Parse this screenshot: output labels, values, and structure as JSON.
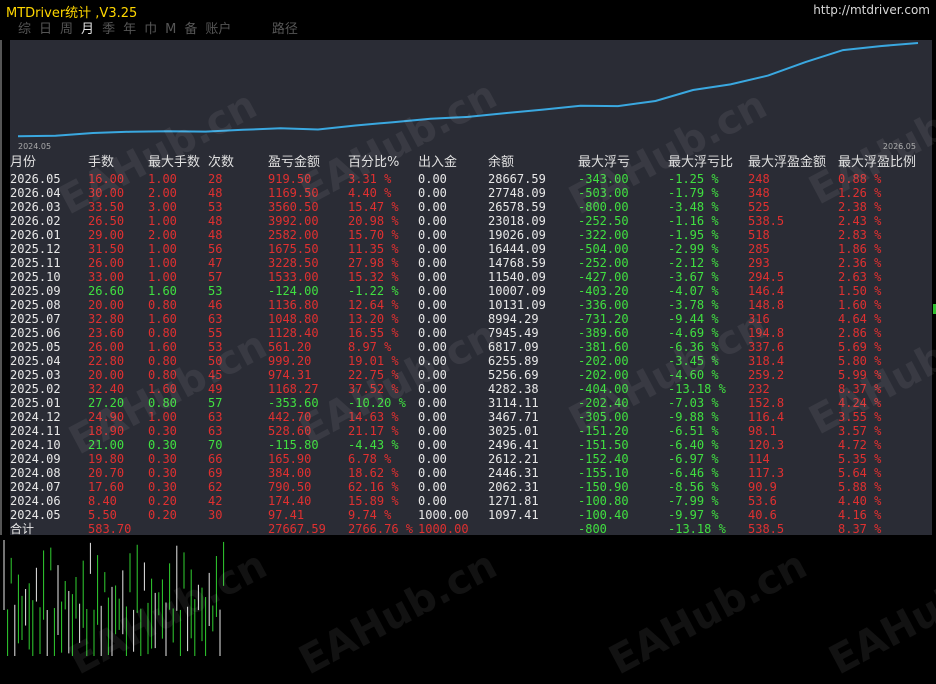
{
  "app_title": "MTDriver统计 ,V3.25",
  "site_url": "http://mtdriver.com",
  "tabs": [
    {
      "label": "综",
      "active": false
    },
    {
      "label": "日",
      "active": false
    },
    {
      "label": "周",
      "active": false
    },
    {
      "label": "月",
      "active": true
    },
    {
      "label": "季",
      "active": false
    },
    {
      "label": "年",
      "active": false
    },
    {
      "label": "巾",
      "active": false
    },
    {
      "label": "M",
      "active": false
    },
    {
      "label": "备",
      "active": false
    },
    {
      "label": "账户",
      "active": false
    },
    {
      "label": "",
      "active": false
    },
    {
      "label": "",
      "active": false
    },
    {
      "label": "路径",
      "active": false
    }
  ],
  "equity_chart": {
    "start_label": "2024.05",
    "end_label": "2026.05",
    "line_color": "#3aa8e0",
    "balances": [
      1097.41,
      1271.81,
      2062.31,
      2446.31,
      2612.21,
      2496.41,
      3025.01,
      3467.71,
      3114.11,
      4282.38,
      5256.69,
      6255.89,
      6817.09,
      7945.49,
      8994.29,
      10131.09,
      10007.09,
      11540.09,
      14768.59,
      16444.09,
      19026.09,
      23018.09,
      26578.59,
      27748.09,
      28667.59
    ]
  },
  "headers": [
    "月份",
    "手数",
    "最大手数",
    "次数",
    "盈亏金额",
    "百分比%",
    "出入金",
    "余额",
    "最大浮亏",
    "最大浮亏比",
    "最大浮盈金额",
    "最大浮盈比例"
  ],
  "rows": [
    {
      "month": "2026.05",
      "lots": "16.00",
      "max_lots": "1.00",
      "count": "28",
      "pl": "919.50",
      "pct": "3.31 %",
      "flow": "0.00",
      "bal": "28667.59",
      "max_dd": "-1,25 %",
      "dd_amt": "-343.00",
      "dd_pct": "-1.25 %",
      "fp_amt": "248",
      "fp_pct": "0.88 %",
      "win": true
    },
    {
      "month": "2026.04",
      "lots": "30.00",
      "max_lots": "2.00",
      "count": "48",
      "pl": "1169.50",
      "pct": "4.40 %",
      "flow": "0.00",
      "bal": "27748.09",
      "dd_amt": "-503.00",
      "dd_pct": "-1.79 %",
      "fp_amt": "348",
      "fp_pct": "1.26 %",
      "win": true
    },
    {
      "month": "2026.03",
      "lots": "33.50",
      "max_lots": "3.00",
      "count": "53",
      "pl": "3560.50",
      "pct": "15.47 %",
      "flow": "0.00",
      "bal": "26578.59",
      "dd_amt": "-800.00",
      "dd_pct": "-3.48 %",
      "fp_amt": "525",
      "fp_pct": "2.38 %",
      "win": true
    },
    {
      "month": "2026.02",
      "lots": "26.50",
      "max_lots": "1.00",
      "count": "48",
      "pl": "3992.00",
      "pct": "20.98 %",
      "flow": "0.00",
      "bal": "23018.09",
      "dd_amt": "-252.50",
      "dd_pct": "-1.16 %",
      "fp_amt": "538.5",
      "fp_pct": "2.43 %",
      "win": true
    },
    {
      "month": "2026.01",
      "lots": "29.00",
      "max_lots": "2.00",
      "count": "48",
      "pl": "2582.00",
      "pct": "15.70 %",
      "flow": "0.00",
      "bal": "19026.09",
      "dd_amt": "-322.00",
      "dd_pct": "-1.95 %",
      "fp_amt": "518",
      "fp_pct": "2.83 %",
      "win": true
    },
    {
      "month": "2025.12",
      "lots": "31.50",
      "max_lots": "1.00",
      "count": "56",
      "pl": "1675.50",
      "pct": "11.35 %",
      "flow": "0.00",
      "bal": "16444.09",
      "dd_amt": "-504.00",
      "dd_pct": "-2.99 %",
      "fp_amt": "285",
      "fp_pct": "1.86 %",
      "win": true
    },
    {
      "month": "2025.11",
      "lots": "26.00",
      "max_lots": "1.00",
      "count": "47",
      "pl": "3228.50",
      "pct": "27.98 %",
      "flow": "0.00",
      "bal": "14768.59",
      "dd_amt": "-252.00",
      "dd_pct": "-2.12 %",
      "fp_amt": "293",
      "fp_pct": "2.36 %",
      "win": true
    },
    {
      "month": "2025.10",
      "lots": "33.00",
      "max_lots": "1.00",
      "count": "57",
      "pl": "1533.00",
      "pct": "15.32 %",
      "flow": "0.00",
      "bal": "11540.09",
      "dd_amt": "-427.00",
      "dd_pct": "-3.67 %",
      "fp_amt": "294.5",
      "fp_pct": "2.63 %",
      "win": true
    },
    {
      "month": "2025.09",
      "lots": "26.60",
      "max_lots": "1.60",
      "count": "53",
      "pl": "-124.00",
      "pct": "-1.22 %",
      "flow": "0.00",
      "bal": "10007.09",
      "dd_amt": "-403.20",
      "dd_pct": "-4.07 %",
      "fp_amt": "146.4",
      "fp_pct": "1.50 %",
      "win": false
    },
    {
      "month": "2025.08",
      "lots": "20.00",
      "max_lots": "0.80",
      "count": "46",
      "pl": "1136.80",
      "pct": "12.64 %",
      "flow": "0.00",
      "bal": "10131.09",
      "dd_amt": "-336.00",
      "dd_pct": "-3.78 %",
      "fp_amt": "148.8",
      "fp_pct": "1.60 %",
      "win": true
    },
    {
      "month": "2025.07",
      "lots": "32.80",
      "max_lots": "1.60",
      "count": "63",
      "pl": "1048.80",
      "pct": "13.20 %",
      "flow": "0.00",
      "bal": "8994.29",
      "dd_amt": "-731.20",
      "dd_pct": "-9.44 %",
      "fp_amt": "316",
      "fp_pct": "4.64 %",
      "win": true
    },
    {
      "month": "2025.06",
      "lots": "23.60",
      "max_lots": "0.80",
      "count": "55",
      "pl": "1128.40",
      "pct": "16.55 %",
      "flow": "0.00",
      "bal": "7945.49",
      "dd_amt": "-389.60",
      "dd_pct": "-4.69 %",
      "fp_amt": "194.8",
      "fp_pct": "2.86 %",
      "win": true
    },
    {
      "month": "2025.05",
      "lots": "26.00",
      "max_lots": "1.60",
      "count": "53",
      "pl": "561.20",
      "pct": "8.97 %",
      "flow": "0.00",
      "bal": "6817.09",
      "dd_amt": "-381.60",
      "dd_pct": "-6.36 %",
      "fp_amt": "337.6",
      "fp_pct": "5.69 %",
      "win": true
    },
    {
      "month": "2025.04",
      "lots": "22.80",
      "max_lots": "0.80",
      "count": "50",
      "pl": "999.20",
      "pct": "19.01 %",
      "flow": "0.00",
      "bal": "6255.89",
      "dd_amt": "-202.00",
      "dd_pct": "-3.45 %",
      "fp_amt": "318.4",
      "fp_pct": "5.80 %",
      "win": true
    },
    {
      "month": "2025.03",
      "lots": "20.00",
      "max_lots": "0.80",
      "count": "45",
      "pl": "974.31",
      "pct": "22.75 %",
      "flow": "0.00",
      "bal": "5256.69",
      "dd_amt": "-202.00",
      "dd_pct": "-4.60 %",
      "fp_amt": "259.2",
      "fp_pct": "5.99 %",
      "win": true
    },
    {
      "month": "2025.02",
      "lots": "32.40",
      "max_lots": "1.60",
      "count": "49",
      "pl": "1168.27",
      "pct": "37.52 %",
      "flow": "0.00",
      "bal": "4282.38",
      "dd_amt": "-404.00",
      "dd_pct": "-13.18 %",
      "fp_amt": "232",
      "fp_pct": "8.37 %",
      "win": true
    },
    {
      "month": "2025.01",
      "lots": "27.20",
      "max_lots": "0.80",
      "count": "57",
      "pl": "-353.60",
      "pct": "-10.20 %",
      "flow": "0.00",
      "bal": "3114.11",
      "dd_amt": "-202.40",
      "dd_pct": "-7.03 %",
      "fp_amt": "152.8",
      "fp_pct": "4.24 %",
      "win": false
    },
    {
      "month": "2024.12",
      "lots": "24.90",
      "max_lots": "1.00",
      "count": "63",
      "pl": "442.70",
      "pct": "14.63 %",
      "flow": "0.00",
      "bal": "3467.71",
      "dd_amt": "-305.00",
      "dd_pct": "-9.88 %",
      "fp_amt": "116.4",
      "fp_pct": "3.55 %",
      "win": true
    },
    {
      "month": "2024.11",
      "lots": "18.90",
      "max_lots": "0.30",
      "count": "63",
      "pl": "528.60",
      "pct": "21.17 %",
      "flow": "0.00",
      "bal": "3025.01",
      "dd_amt": "-151.20",
      "dd_pct": "-6.51 %",
      "fp_amt": "98.1",
      "fp_pct": "3.57 %",
      "win": true
    },
    {
      "month": "2024.10",
      "lots": "21.00",
      "max_lots": "0.30",
      "count": "70",
      "pl": "-115.80",
      "pct": "-4.43 %",
      "flow": "0.00",
      "bal": "2496.41",
      "dd_amt": "-151.50",
      "dd_pct": "-6.40 %",
      "fp_amt": "120.3",
      "fp_pct": "4.72 %",
      "win": false
    },
    {
      "month": "2024.09",
      "lots": "19.80",
      "max_lots": "0.30",
      "count": "66",
      "pl": "165.90",
      "pct": "6.78 %",
      "flow": "0.00",
      "bal": "2612.21",
      "dd_amt": "-152.40",
      "dd_pct": "-6.97 %",
      "fp_amt": "114",
      "fp_pct": "5.35 %",
      "win": true
    },
    {
      "month": "2024.08",
      "lots": "20.70",
      "max_lots": "0.30",
      "count": "69",
      "pl": "384.00",
      "pct": "18.62 %",
      "flow": "0.00",
      "bal": "2446.31",
      "dd_amt": "-155.10",
      "dd_pct": "-6.46 %",
      "fp_amt": "117.3",
      "fp_pct": "5.64 %",
      "win": true
    },
    {
      "month": "2024.07",
      "lots": "17.60",
      "max_lots": "0.30",
      "count": "62",
      "pl": "790.50",
      "pct": "62.16 %",
      "flow": "0.00",
      "bal": "2062.31",
      "dd_amt": "-150.90",
      "dd_pct": "-8.56 %",
      "fp_amt": "90.9",
      "fp_pct": "5.88 %",
      "win": true
    },
    {
      "month": "2024.06",
      "lots": "8.40",
      "max_lots": "0.20",
      "count": "42",
      "pl": "174.40",
      "pct": "15.89 %",
      "flow": "0.00",
      "bal": "1271.81",
      "dd_amt": "-100.80",
      "dd_pct": "-7.99 %",
      "fp_amt": "53.6",
      "fp_pct": "4.40 %",
      "win": true
    },
    {
      "month": "2024.05",
      "lots": "5.50",
      "max_lots": "0.20",
      "count": "30",
      "pl": "97.41",
      "pct": "9.74 %",
      "flow": "1000.00",
      "bal": "1097.41",
      "dd_amt": "-100.40",
      "dd_pct": "-9.97 %",
      "fp_amt": "40.6",
      "fp_pct": "4.16 %",
      "win": true
    }
  ],
  "total": {
    "label": "合计",
    "lots": "583.70",
    "pl": "27667.59",
    "pct": "2766.76 %",
    "flow": "1000.00",
    "dd_amt": "-800",
    "dd_pct": "-13.18 %",
    "fp_amt": "538.5",
    "fp_pct": "8.37 %"
  },
  "watermark": "EAHub.cn"
}
